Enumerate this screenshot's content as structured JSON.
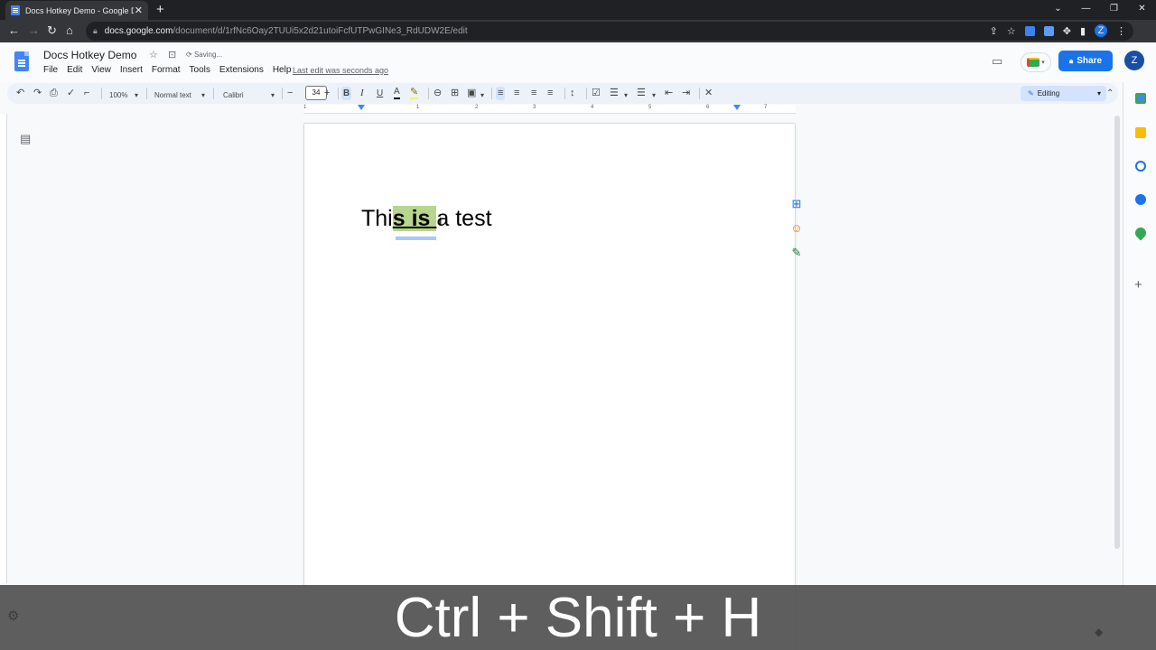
{
  "browser": {
    "tab_title": "Docs Hotkey Demo - Google Do",
    "tab_close": "✕",
    "new_tab": "+",
    "url_host": "docs.google.com",
    "url_path": "/document/d/1rfNc6Oay2TUUi5x2d21utoiFcfUTPwGINe3_RdUDW2E/edit",
    "profile_initial": "Z",
    "window_controls": [
      "⌄",
      "—",
      "❐",
      "✕"
    ]
  },
  "docs": {
    "title": "Docs Hotkey Demo",
    "saving": "Saving...",
    "menu": [
      "File",
      "Edit",
      "View",
      "Insert",
      "Format",
      "Tools",
      "Extensions",
      "Help"
    ],
    "last_edit": "Last edit was seconds ago",
    "share_label": "Share",
    "avatar_initial": "Z"
  },
  "toolbar": {
    "zoom": "100%",
    "style": "Normal text",
    "font": "Calibri",
    "font_size": "34",
    "bold": "B",
    "italic": "I",
    "underline": "U",
    "text_color": "A",
    "mode": "Editing"
  },
  "ruler": {
    "numbers": [
      "1",
      "1",
      "2",
      "3",
      "4",
      "5",
      "6",
      "7"
    ]
  },
  "document": {
    "text_before": "Thi",
    "text_highlight": "s is ",
    "text_after": "a test"
  },
  "caption": {
    "text": "Ctrl + Shift + H"
  },
  "colors": {
    "highlight": "#b7d58c",
    "share_blue": "#1a73e8",
    "caption_bg": "#555555"
  }
}
